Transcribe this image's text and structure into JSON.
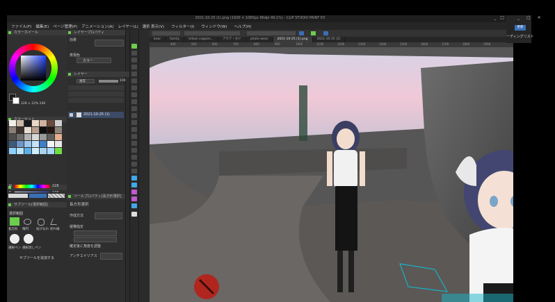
{
  "titlebar": {
    "title": "2021-10-25 (1).png (1920 × 1080px 96dpi 49.1%) - CLIP STUDIO PAINT EX",
    "controls": [
      "_",
      "□",
      "✕"
    ]
  },
  "menus": [
    "ファイル(F)",
    "編集(E)",
    "ページ管理(P)",
    "アニメーション(A)",
    "レイヤー(L)",
    "選択範囲(S)",
    "表示(V)",
    "フィルター(I)",
    "ウィンドウ(W)",
    "ヘルプ(H)"
  ],
  "color_panel": {
    "title": "カラーホイール",
    "readout": "228 × 22%  246",
    "swatch_title": "カラーセット",
    "slider_title": "カラースライダー",
    "sliders": [
      {
        "label": "H",
        "value": "228"
      },
      {
        "label": "S",
        "value": "106"
      },
      {
        "label": "V",
        "value": "108"
      }
    ],
    "swatches": [
      "#f2efe9",
      "#c9b8a6",
      "#1b1b1b",
      "#e9d7c6",
      "#d2b0a0",
      "#6a4a3c",
      "#cfcfcf",
      "#8a7f75",
      "#3d332e",
      "#e6dcd0",
      "#b99e8d",
      "#0f0f0f",
      "#251612",
      "#8f837a",
      "#4e4e4e",
      "#6c6c6c",
      "#b3b3b3",
      "#d9d9d9",
      "#9a9a9a",
      "#5e5e5e",
      "#e4b08f",
      "#3f5b7a",
      "#6f96c6",
      "#9ec7ef",
      "#c4e3fb",
      "#3d7fc8",
      "#f5f5f5",
      "#e9e9e9",
      "#8ed0ff",
      "#b9e4ff",
      "#5bb0e6",
      "#d0f0ff",
      "#a8d4f2",
      "#aad8ff",
      "#6ee042"
    ]
  },
  "mid_panel": {
    "layer_prop_title": "レイヤープロパティ",
    "effect_label": "効果",
    "display_color_label": "表現色",
    "color_mode": "カラー",
    "layer_title": "レイヤー",
    "blend_mode": "通常",
    "opacity": "100",
    "layer_name": "2021-10-25 (1)"
  },
  "tool_panel": {
    "sub_tool_title": "サブツール[選択範囲]",
    "tool_prop_title": "ツールプロパティ[長方形選択]",
    "tool_name": "長方形選択",
    "selection_title": "選択範囲",
    "creation_label": "作成方法",
    "aspect_label": "縦横指定",
    "confirm_label": "確定後に角度を調整",
    "antialias_label": "アンチエイリアス",
    "tools": [
      "長方形",
      "楕円",
      "投げなわ",
      "折れ線"
    ],
    "pen_labels": [
      "選択ペン",
      "選択消しペン"
    ],
    "add_sub_tool": "サブツールを追加する"
  },
  "tabs": [
    "bear",
    "family",
    "Urban coppen...",
    "アクア・ホド",
    "photo-wear",
    "2021-10-25 (1).png",
    "2021-10-25 (2)"
  ],
  "ruler_ticks": [
    "400",
    "500",
    "600",
    "700",
    "800",
    "900",
    "1000",
    "1100",
    "1200",
    "1300",
    "1400",
    "1500",
    "1600",
    "1700",
    "1800",
    "1900"
  ],
  "right_panel": {
    "update_label": "更新",
    "listing": "ーディングリスト"
  },
  "colors": {
    "accent_green": "#6bcf4b",
    "app_bg": "#2b2b2b",
    "active_blue": "#3a6fb6"
  }
}
